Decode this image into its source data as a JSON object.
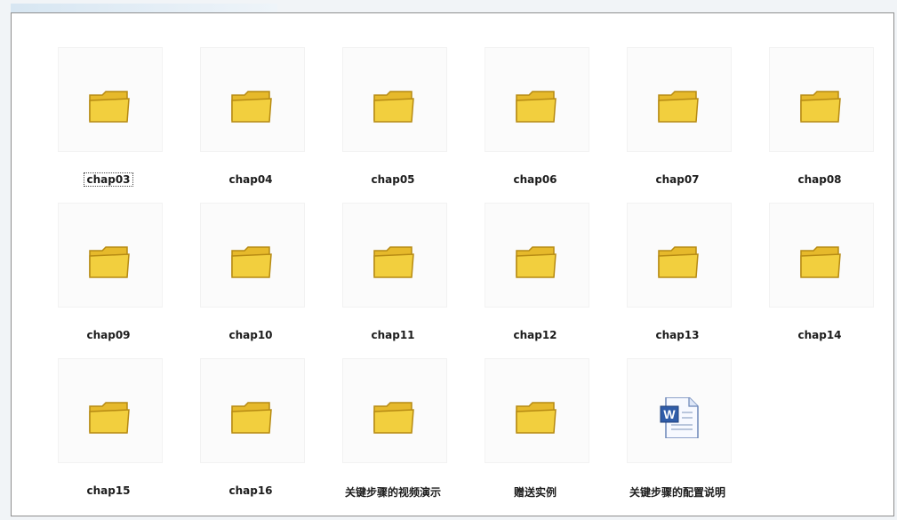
{
  "explorer": {
    "items": [
      {
        "label": "chap03",
        "icon": "folder-icon"
      },
      {
        "label": "chap04",
        "icon": "folder-icon"
      },
      {
        "label": "chap05",
        "icon": "folder-icon"
      },
      {
        "label": "chap06",
        "icon": "folder-icon"
      },
      {
        "label": "chap07",
        "icon": "folder-icon"
      },
      {
        "label": "chap08",
        "icon": "folder-icon"
      },
      {
        "label": "chap09",
        "icon": "folder-icon"
      },
      {
        "label": "chap10",
        "icon": "folder-icon"
      },
      {
        "label": "chap11",
        "icon": "folder-icon"
      },
      {
        "label": "chap12",
        "icon": "folder-icon"
      },
      {
        "label": "chap13",
        "icon": "folder-icon"
      },
      {
        "label": "chap14",
        "icon": "folder-icon"
      },
      {
        "label": "chap15",
        "icon": "folder-icon"
      },
      {
        "label": "chap16",
        "icon": "folder-icon"
      },
      {
        "label": "关键步骤的视频演示",
        "icon": "folder-icon"
      },
      {
        "label": "赠送实例",
        "icon": "folder-icon"
      },
      {
        "label": "关键步骤的配置说明",
        "icon": "word-document-icon"
      }
    ],
    "colors": {
      "folder_front": "#f2cf3e",
      "folder_back": "#e6b92b",
      "folder_outline": "#b68a13",
      "word_blue": "#2f5ca8"
    }
  }
}
